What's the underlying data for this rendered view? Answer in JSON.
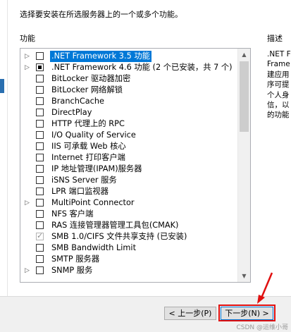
{
  "instructions": "选择要安装在所选服务器上的一个或多个功能。",
  "features_heading": "功能",
  "description_heading": "描述",
  "description_lines": [
    ".NET F",
    "Frame",
    "建应用",
    "序可提",
    "个人身",
    "信，以",
    "的功能"
  ],
  "features": [
    {
      "label": ".NET Framework 3.5 功能",
      "expandable": true,
      "state": "unchecked",
      "selected": true
    },
    {
      "label": ".NET Framework 4.6 功能 (2 个已安装，共 7 个)",
      "expandable": true,
      "state": "partial",
      "selected": false
    },
    {
      "label": "BitLocker 驱动器加密",
      "expandable": false,
      "state": "unchecked",
      "selected": false
    },
    {
      "label": "BitLocker 网络解锁",
      "expandable": false,
      "state": "unchecked",
      "selected": false
    },
    {
      "label": "BranchCache",
      "expandable": false,
      "state": "unchecked",
      "selected": false
    },
    {
      "label": "DirectPlay",
      "expandable": false,
      "state": "unchecked",
      "selected": false
    },
    {
      "label": "HTTP 代理上的 RPC",
      "expandable": false,
      "state": "unchecked",
      "selected": false
    },
    {
      "label": "I/O Quality of Service",
      "expandable": false,
      "state": "unchecked",
      "selected": false
    },
    {
      "label": "IIS 可承载 Web 核心",
      "expandable": false,
      "state": "unchecked",
      "selected": false
    },
    {
      "label": "Internet 打印客户端",
      "expandable": false,
      "state": "unchecked",
      "selected": false
    },
    {
      "label": "IP 地址管理(IPAM)服务器",
      "expandable": false,
      "state": "unchecked",
      "selected": false
    },
    {
      "label": "iSNS Server 服务",
      "expandable": false,
      "state": "unchecked",
      "selected": false
    },
    {
      "label": "LPR 端口监视器",
      "expandable": false,
      "state": "unchecked",
      "selected": false
    },
    {
      "label": "MultiPoint Connector",
      "expandable": true,
      "state": "unchecked",
      "selected": false
    },
    {
      "label": "NFS 客户端",
      "expandable": false,
      "state": "unchecked",
      "selected": false
    },
    {
      "label": "RAS 连接管理器管理工具包(CMAK)",
      "expandable": false,
      "state": "unchecked",
      "selected": false
    },
    {
      "label": "SMB 1.0/CIFS 文件共享支持 (已安装)",
      "expandable": false,
      "state": "checked-disabled",
      "selected": false
    },
    {
      "label": "SMB Bandwidth Limit",
      "expandable": false,
      "state": "unchecked",
      "selected": false
    },
    {
      "label": "SMTP 服务器",
      "expandable": false,
      "state": "unchecked",
      "selected": false
    },
    {
      "label": "SNMP 服务",
      "expandable": true,
      "state": "unchecked",
      "selected": false
    }
  ],
  "buttons": {
    "previous": "< 上一步(P)",
    "next": "下一步(N) >"
  },
  "watermark": "CSDN @运维小哥",
  "colors": {
    "selection": "#0078d7",
    "highlight": "#e01010"
  }
}
